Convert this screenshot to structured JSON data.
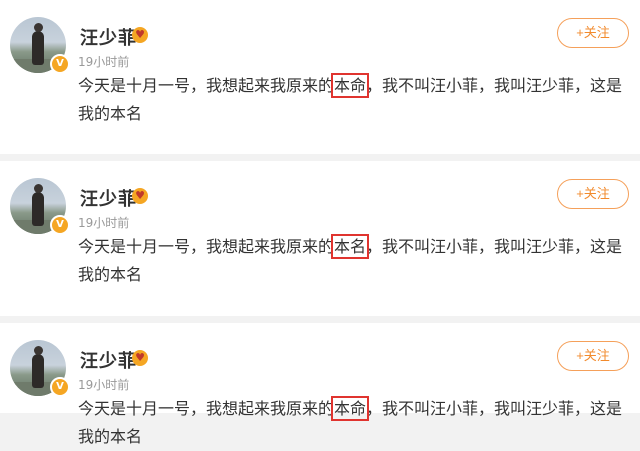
{
  "posts": [
    {
      "name": "汪少菲",
      "verified_mark": "V",
      "member_glyph": "♥",
      "time": "19小时前",
      "text_before": "今天是十月一号，我想起来我原来的",
      "highlight": "本命",
      "text_after": "，我不叫汪小菲，我叫汪少菲，这是我的本名",
      "follow_label": "+关注"
    },
    {
      "name": "汪少菲",
      "verified_mark": "V",
      "member_glyph": "♥",
      "time": "19小时前",
      "text_before": "今天是十月一号，我想起来我原来的",
      "highlight": "本名",
      "text_after": "，我不叫汪小菲，我叫汪少菲，这是我的本名",
      "follow_label": "+关注"
    },
    {
      "name": "汪少菲",
      "verified_mark": "V",
      "member_glyph": "♥",
      "time": "19小时前",
      "text_before": "今天是十月一号，我想起来我原来的",
      "highlight": "本命",
      "text_after": "，我不叫汪小菲，我叫汪少菲，这是我的本名",
      "follow_label": "+关注"
    }
  ],
  "colors": {
    "accent": "#f28a2c",
    "highlight_box": "#e0342f",
    "verified": "#f5a623"
  }
}
